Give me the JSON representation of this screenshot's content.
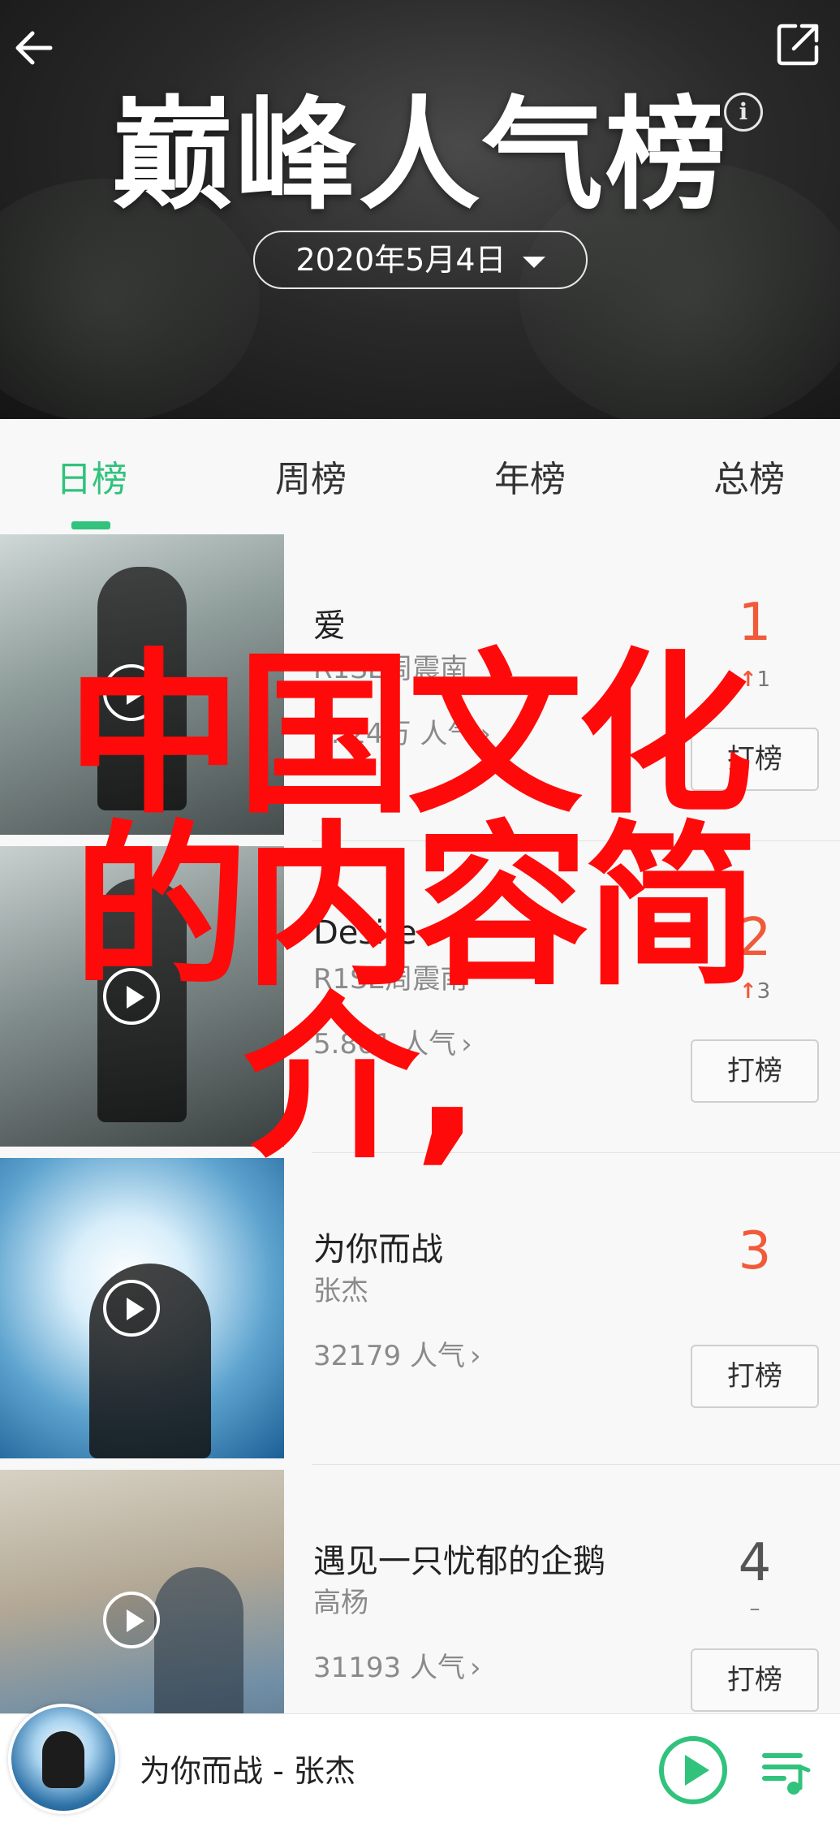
{
  "header": {
    "title": "巅峰人气榜",
    "info_label": "i",
    "date": "2020年5月4日"
  },
  "tabs": [
    {
      "label": "日榜",
      "active": true
    },
    {
      "label": "周榜",
      "active": false
    },
    {
      "label": "年榜",
      "active": false
    },
    {
      "label": "总榜",
      "active": false
    }
  ],
  "songs": [
    {
      "name": "爱",
      "artist": "R1SE周震南",
      "popularity": "1..24万 人气",
      "rank": "1",
      "change": "1",
      "change_dir": "up",
      "vote_label": "打榜"
    },
    {
      "name": "Desire",
      "artist": "R1SE周震南",
      "popularity": "5.861 人气",
      "rank": "2",
      "change": "3",
      "change_dir": "up",
      "vote_label": "打榜"
    },
    {
      "name": "为你而战",
      "artist": "张杰",
      "popularity": "32179 人气",
      "rank": "3",
      "change": "",
      "change_dir": "none",
      "vote_label": "打榜"
    },
    {
      "name": "遇见一只忧郁的企鹅",
      "artist": "高杨",
      "popularity": "31193 人气",
      "rank": "4",
      "change": "–",
      "change_dir": "same",
      "vote_label": "打榜"
    }
  ],
  "overlay_text": {
    "line1": "中国文化",
    "line2": "的内容简",
    "line3": "介,"
  },
  "player": {
    "now_playing": "为你而战 - 张杰"
  },
  "colors": {
    "accent": "#31c27c",
    "rank_red": "#f05a3a",
    "overlay_red": "#ff0a0a"
  },
  "icons": {
    "back": "back-arrow-icon",
    "share": "share-icon",
    "info": "info-icon",
    "play": "play-icon",
    "queue": "playlist-icon"
  }
}
